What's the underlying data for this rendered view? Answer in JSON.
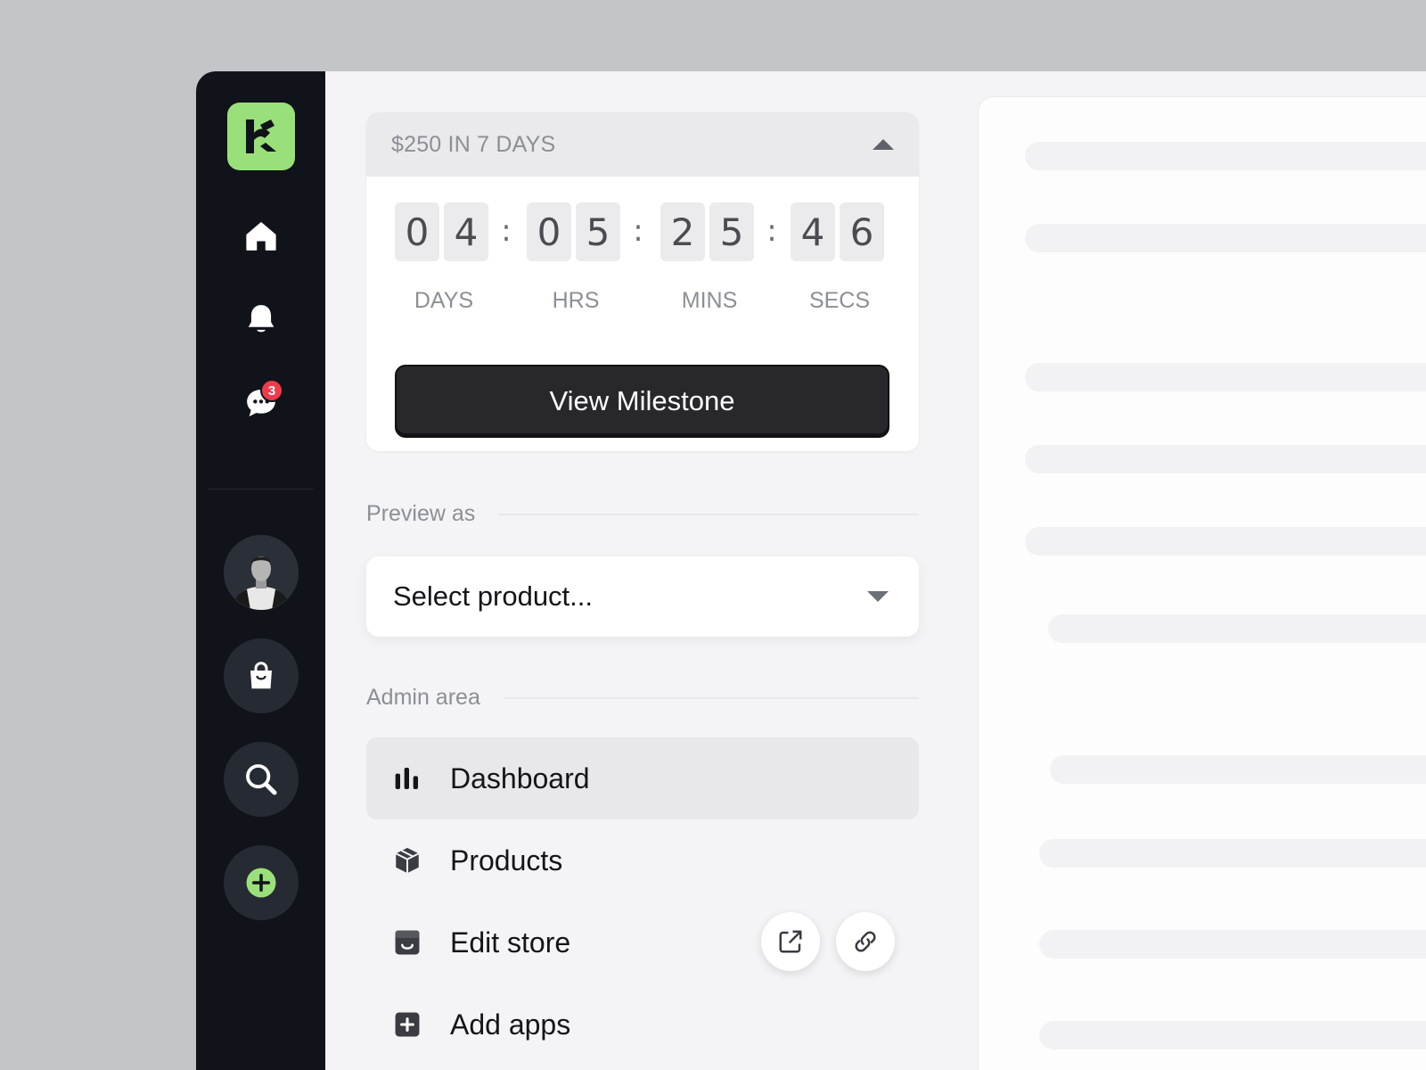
{
  "milestone": {
    "title": "$250 IN 7 DAYS",
    "digits": [
      "0",
      "4",
      "0",
      "5",
      "2",
      "5",
      "4",
      "6"
    ],
    "separator": ":",
    "labels": [
      "DAYS",
      "HRS",
      "MINS",
      "SECS"
    ],
    "button_label": "View Milestone"
  },
  "sidebar": {
    "logo_icon": "brand-logo-icon",
    "nav": [
      "home-icon",
      "bell-icon",
      "chat-icon"
    ],
    "messages_badge": "3",
    "actions": [
      "avatar",
      "shopping-bag-icon",
      "search-icon",
      "plus-circle-icon"
    ],
    "accent_color": "#9ae07a"
  },
  "preview": {
    "label": "Preview as",
    "select_placeholder": "Select product..."
  },
  "admin": {
    "label": "Admin area",
    "items": [
      {
        "label": "Dashboard",
        "icon": "bar-chart-icon",
        "active": true
      },
      {
        "label": "Products",
        "icon": "box-icon",
        "active": false
      },
      {
        "label": "Edit store",
        "icon": "store-icon",
        "active": false
      },
      {
        "label": "Add apps",
        "icon": "plus-square-icon",
        "active": false
      }
    ],
    "store_actions": [
      "share-icon",
      "link-icon"
    ]
  }
}
